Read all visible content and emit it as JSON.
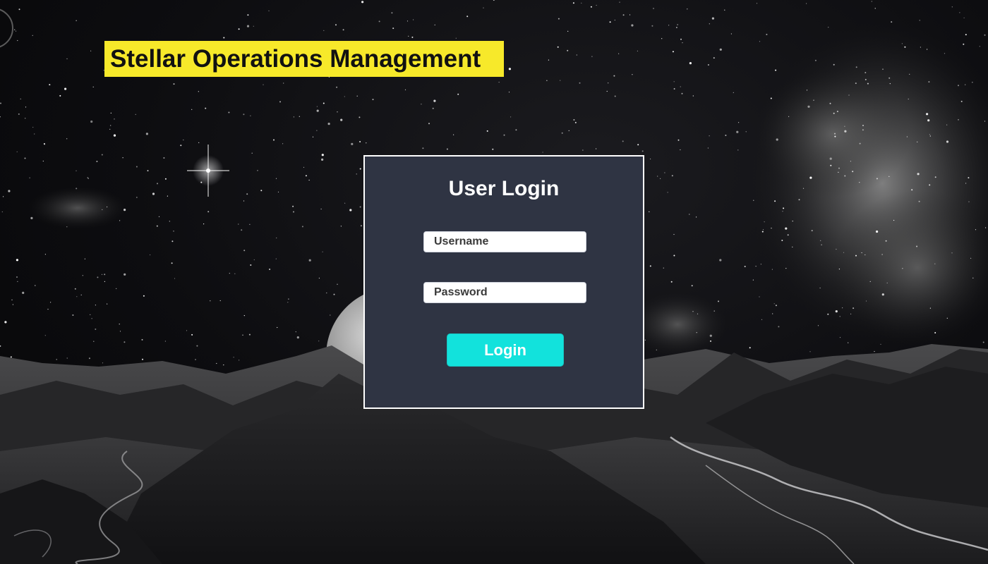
{
  "header": {
    "title": "Stellar Operations Management"
  },
  "login": {
    "heading": "User Login",
    "username_placeholder": "Username",
    "password_placeholder": "Password",
    "button_label": "Login"
  },
  "colors": {
    "title_background": "#f7e92a",
    "panel_background": "#2f3443",
    "panel_border": "#ffffff",
    "button_background": "#12e2dc"
  }
}
